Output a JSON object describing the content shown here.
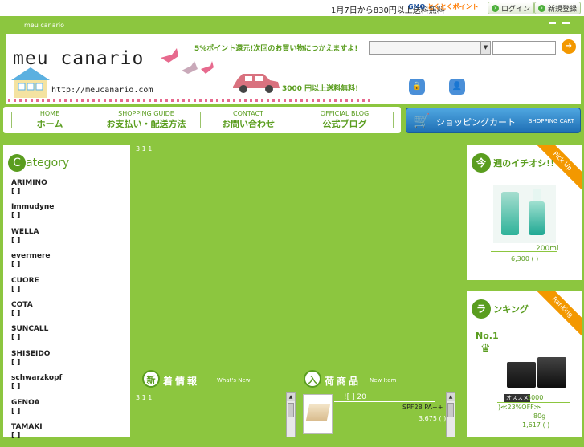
{
  "topbar": {
    "notice": "1月7日から830円以上送料無料",
    "gmo_a": "GMO",
    "gmo_b": "とくとくポイント",
    "login": "ログイン",
    "register": "新規登録"
  },
  "site": {
    "name": "meu canario"
  },
  "header": {
    "logo": "meu canario",
    "url": "http://meucanario.com",
    "promo_points": "5%ポイント還元!次回のお買い物につかえますよ!",
    "promo_shipping": "3000 円以上送料無料!"
  },
  "nav": [
    {
      "en": "HOME",
      "jp": "ホーム"
    },
    {
      "en": "SHOPPING GUIDE",
      "jp": "お支払い・配送方法"
    },
    {
      "en": "CONTACT",
      "jp": "お問い合わせ"
    },
    {
      "en": "OFFICIAL BLOG",
      "jp": "公式ブログ"
    }
  ],
  "cart": {
    "jp": "ショッピングカート",
    "en": "SHOPPING CART"
  },
  "category": {
    "title": "ategory",
    "initial": "C",
    "items": [
      {
        "name": "ARIMINO",
        "sub": "[ ]"
      },
      {
        "name": "Immudyne",
        "sub": "[ ]"
      },
      {
        "name": "WELLA",
        "sub": "[ ]"
      },
      {
        "name": "evermere",
        "sub": "[ ]"
      },
      {
        "name": "CUORE",
        "sub": "[ ]"
      },
      {
        "name": "COTA",
        "sub": "[ ]"
      },
      {
        "name": "SUNCALL",
        "sub": "[ ]"
      },
      {
        "name": "SHISEIDO",
        "sub": "[ ]"
      },
      {
        "name": "schwarzkopf",
        "sub": "[ ]"
      },
      {
        "name": "GENOA",
        "sub": "[ ]"
      },
      {
        "name": "TAMAKI",
        "sub": "[ ]"
      }
    ]
  },
  "center": {
    "count_top": "3 1 1",
    "count_bottom": "3 1 1",
    "news": {
      "initial": "新",
      "jp": "着情報",
      "en": "What's New"
    },
    "newitem": {
      "initial": "入",
      "jp": "荷商品",
      "en": "New Item"
    },
    "item_title": "![  ]          20",
    "item_sub": "SPF28 PA++",
    "item_price": "3,675 (  )"
  },
  "pickup": {
    "initial": "今",
    "title": "週のイチオシ!!",
    "ribbon": "Pick Up",
    "name": "200ml",
    "price": "6,300 (  )"
  },
  "ranking": {
    "initial": "ラ",
    "title": "ンキング",
    "ribbon": "Ranking",
    "no1": "No.1",
    "badge": "オススメ",
    "price": "3000",
    "off": ")≪23%OFF≫",
    "size": "80g",
    "price2": "1,617 (  )"
  }
}
